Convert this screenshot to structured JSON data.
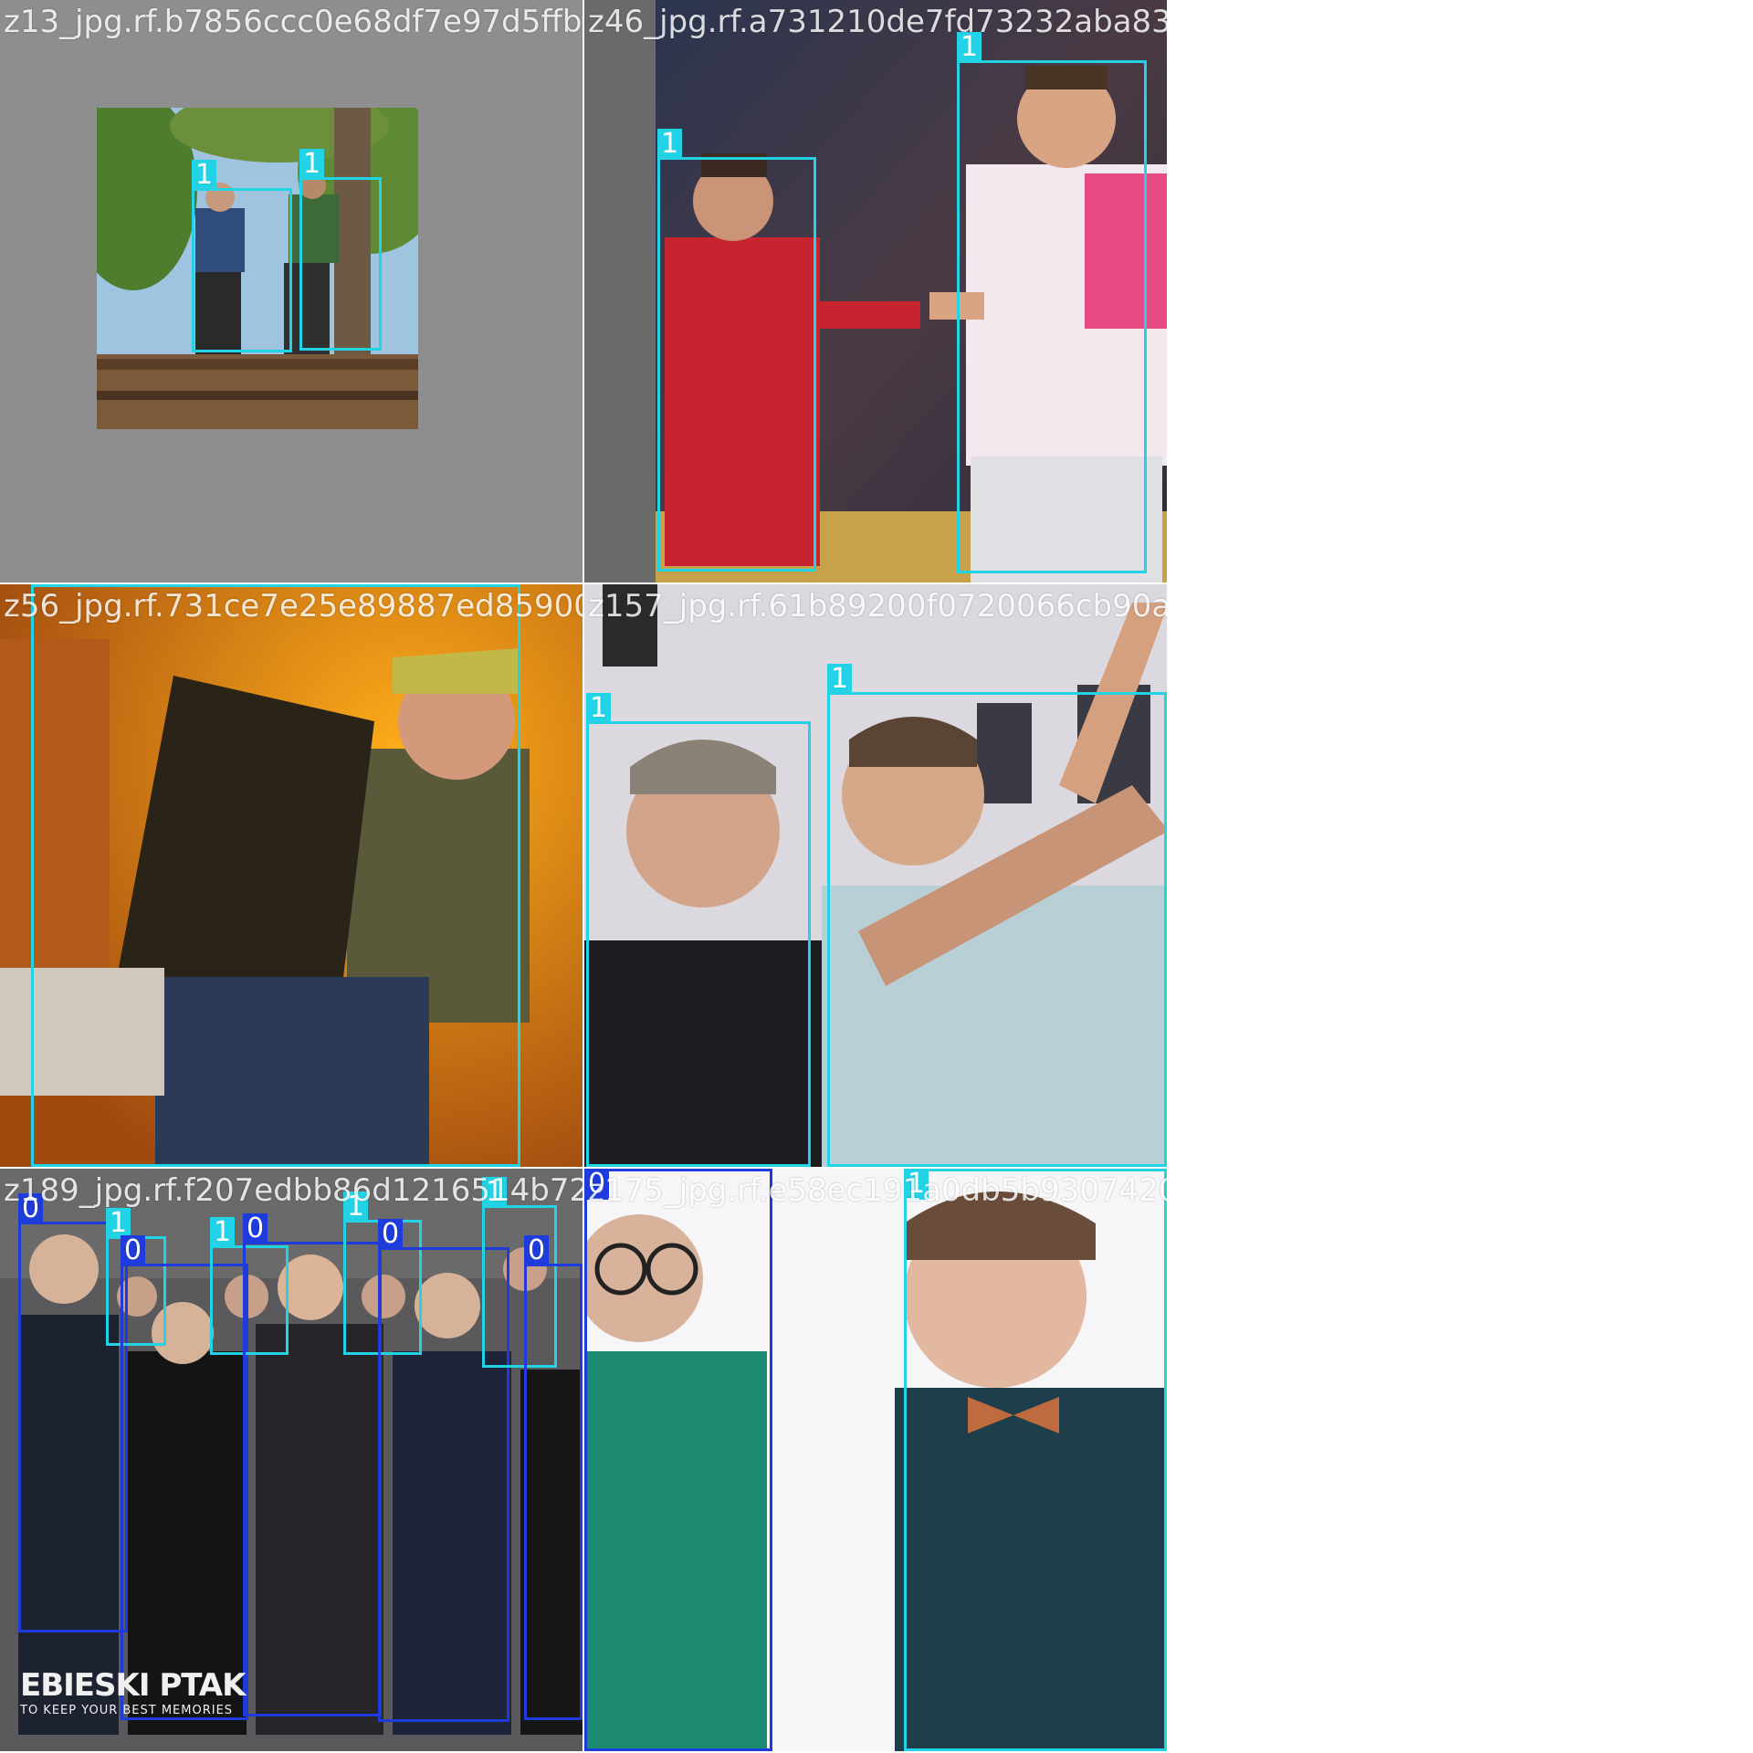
{
  "tiles": [
    {
      "filename": "z13_jpg.rf.b7856ccc0e68df7e97d5ffb5746f",
      "boxes": [
        {
          "label": "1"
        },
        {
          "label": "1"
        }
      ]
    },
    {
      "filename": "z46_jpg.rf.a731210de7fd73232aba8321e1cca",
      "boxes": [
        {
          "label": "1"
        },
        {
          "label": "1"
        }
      ]
    },
    {
      "filename": "z56_jpg.rf.731ce7e25e89887ed85900f3b3b45",
      "boxes": [
        {
          "label": "1"
        }
      ]
    },
    {
      "filename": "z157_jpg.rf.61b89200f0720066cb90a7cadd3a",
      "boxes": [
        {
          "label": "1"
        },
        {
          "label": "1"
        }
      ]
    },
    {
      "filename": "z189_jpg.rf.f207edbb86d1216514b724f5299",
      "watermark": {
        "big": "EBIESKI PTAK",
        "small": "TO KEEP YOUR BEST MEMORIES"
      },
      "boxes": [
        {
          "label": "0"
        },
        {
          "label": "1"
        },
        {
          "label": "0"
        },
        {
          "label": "1"
        },
        {
          "label": "0"
        },
        {
          "label": "1"
        },
        {
          "label": "0"
        },
        {
          "label": "1"
        },
        {
          "label": "0"
        }
      ]
    },
    {
      "filename": "z175_jpg.rf.e58ec191a0db5b930742036e9b05d",
      "boxes": [
        {
          "label": "0"
        },
        {
          "label": "1"
        }
      ]
    }
  ],
  "colors": {
    "class_1": "#22d3e6",
    "class_0": "#1e3bdc",
    "pad_gray": "#808080"
  }
}
